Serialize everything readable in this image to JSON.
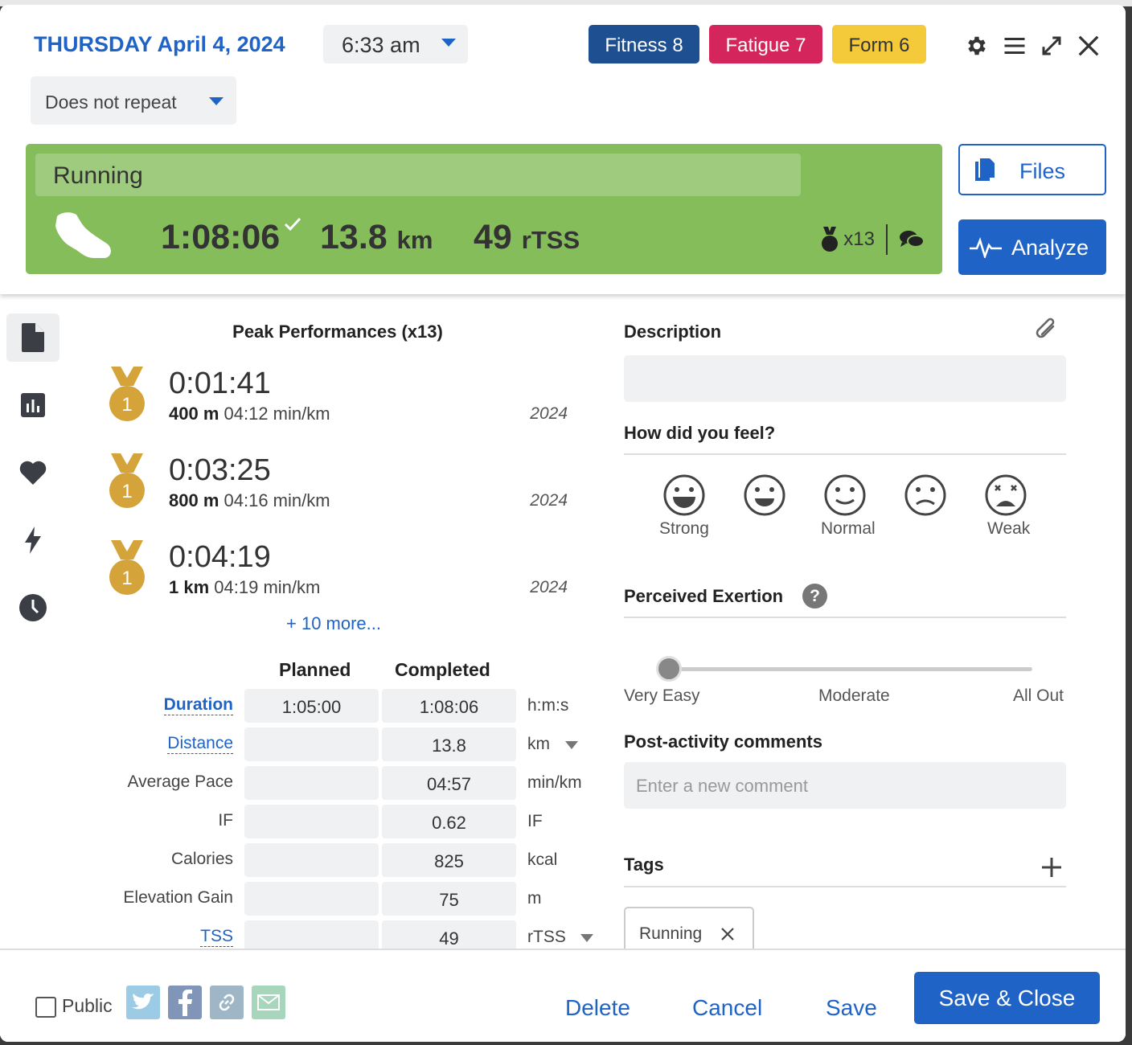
{
  "header": {
    "weekday": "THURSDAY",
    "date": "April 4, 2024",
    "time": "6:33 am",
    "repeat": "Does not repeat",
    "fitness_label": "Fitness 8",
    "fatigue_label": "Fatigue 7",
    "form_label": "Form 6"
  },
  "workout": {
    "title": "Running",
    "duration": "1:08:06",
    "distance_value": "13.8",
    "distance_unit": "km",
    "tss_value": "49",
    "tss_unit": "rTSS",
    "peak_count": "x13"
  },
  "buttons": {
    "files": "Files",
    "analyze": "Analyze"
  },
  "peaks": {
    "title": "Peak Performances (x13)",
    "items": [
      {
        "rank": "1",
        "time": "0:01:41",
        "distance": "400 m",
        "pace": "04:12 min/km",
        "year": "2024"
      },
      {
        "rank": "1",
        "time": "0:03:25",
        "distance": "800 m",
        "pace": "04:16 min/km",
        "year": "2024"
      },
      {
        "rank": "1",
        "time": "0:04:19",
        "distance": "1 km",
        "pace": "04:19 min/km",
        "year": "2024"
      }
    ],
    "more": "+ 10 more..."
  },
  "metrics": {
    "planned_header": "Planned",
    "completed_header": "Completed",
    "rows": [
      {
        "label": "Duration",
        "planned": "1:05:00",
        "completed": "1:08:06",
        "unit": "h:m:s"
      },
      {
        "label": "Distance",
        "planned": "",
        "completed": "13.8",
        "unit": "km"
      },
      {
        "label": "Average Pace",
        "planned": "",
        "completed": "04:57",
        "unit": "min/km"
      },
      {
        "label": "IF",
        "planned": "",
        "completed": "0.62",
        "unit": "IF"
      },
      {
        "label": "Calories",
        "planned": "",
        "completed": "825",
        "unit": "kcal"
      },
      {
        "label": "Elevation Gain",
        "planned": "",
        "completed": "75",
        "unit": "m"
      },
      {
        "label": "TSS",
        "planned": "",
        "completed": "49",
        "unit": "rTSS"
      }
    ]
  },
  "right": {
    "description_title": "Description",
    "feel_title": "How did you feel?",
    "feel_labels": {
      "strong": "Strong",
      "normal": "Normal",
      "weak": "Weak"
    },
    "exertion_title": "Perceived Exertion",
    "exertion_help": "?",
    "exertion_labels": {
      "low": "Very Easy",
      "mid": "Moderate",
      "high": "All Out"
    },
    "exertion_value": 0,
    "comments_title": "Post-activity comments",
    "comments_placeholder": "Enter a new comment",
    "tags_title": "Tags",
    "tags": [
      "Running"
    ]
  },
  "footer": {
    "public_label": "Public",
    "delete": "Delete",
    "cancel": "Cancel",
    "save": "Save",
    "save_close": "Save & Close"
  },
  "colors": {
    "accent": "#1f63c6",
    "fitness": "#1d4f91",
    "fatigue": "#d4265c",
    "form": "#f4c93a",
    "workout_green": "#84bd5a",
    "medal_gold": "#d4a43a"
  }
}
